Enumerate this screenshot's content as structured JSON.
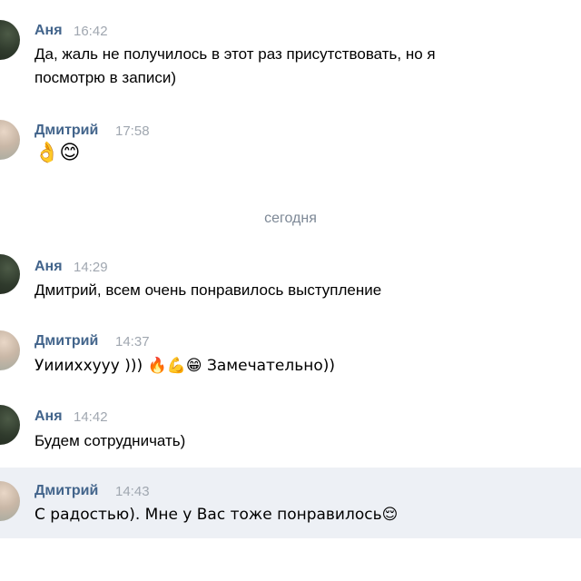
{
  "messages": [
    {
      "author": "Аня",
      "time": "16:42",
      "lines": [
        "Да, жаль не получилось в этот раз присутствовать, но я",
        "посмотрю в записи)"
      ],
      "avatar": "anya-avatar"
    },
    {
      "author": "Дмитрий",
      "time": "17:58",
      "text": "👌😊",
      "avatar": "dmitry-avatar"
    },
    {
      "author": "Аня",
      "time": "14:29",
      "text": "Дмитрий, всем очень понравилось выступление",
      "avatar": "anya-avatar"
    },
    {
      "author": "Дмитрий",
      "time": "14:37",
      "text": "Уиииххууу ))) 🔥💪😁 Замечательно))",
      "avatar": "dmitry-avatar"
    },
    {
      "author": "Аня",
      "time": "14:42",
      "text": "Будем сотрудничать)",
      "avatar": "anya-avatar"
    },
    {
      "author": "Дмитрий",
      "time": "14:43",
      "text": "С радостью). Мне у Вас тоже понравилось😌",
      "avatar": "dmitry-avatar"
    }
  ],
  "date_separator": "сегодня",
  "colors": {
    "author": "#42648b",
    "time": "#a0a7b0",
    "highlight": "#edf0f5"
  }
}
